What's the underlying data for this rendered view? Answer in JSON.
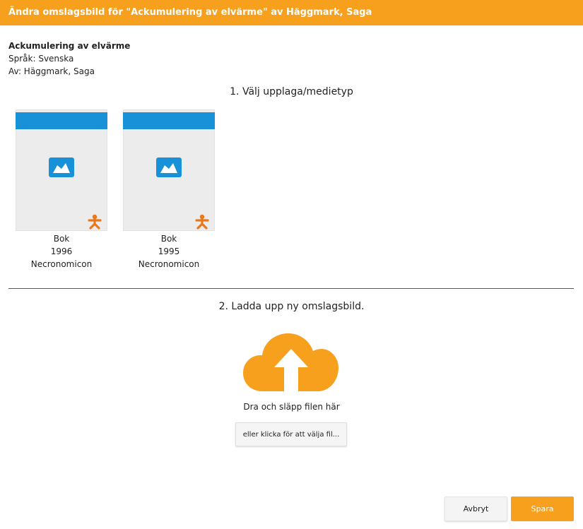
{
  "dialog": {
    "title": "Ändra omslagsbild för \"Ackumulering av elvärme\" av Häggmark, Saga",
    "accent_color": "#f7a01d"
  },
  "book": {
    "title": "Ackumulering av elvärme",
    "language": "Språk: Svenska",
    "author": "Av: Häggmark, Saga"
  },
  "step1": {
    "heading": "1. Välj upplaga/medietyp",
    "editions": [
      {
        "type": "Bok",
        "year": "1996",
        "publisher": "Necronomicon",
        "icon": "image-placeholder-icon"
      },
      {
        "type": "Bok",
        "year": "1995",
        "publisher": "Necronomicon",
        "icon": "image-placeholder-icon"
      }
    ]
  },
  "step2": {
    "heading": "2. Ladda upp ny omslagsbild.",
    "icon": "cloud-upload-icon",
    "drop_text": "Dra och släpp filen här",
    "choose_button": "eller klicka för att välja fil..."
  },
  "footer": {
    "cancel_label": "Avbryt",
    "save_label": "Spara"
  }
}
